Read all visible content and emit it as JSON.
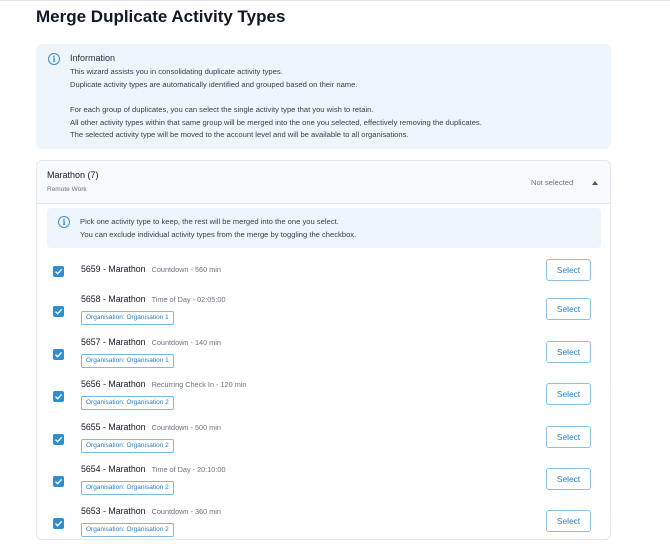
{
  "page": {
    "title": "Merge Duplicate Activity Types"
  },
  "info": {
    "heading": "Information",
    "lines": [
      "This wizard assists you in consolidating duplicate activity types.",
      "Duplicate activity types are automatically identified and grouped based on their name.",
      "For each group of duplicates, you can select the single activity type that you wish to retain.",
      "All other activity types within that same group will be merged into the one you selected, effectively removing the duplicates.",
      "The selected activity type will be moved to the account level and will be available to all organisations."
    ]
  },
  "group": {
    "title": "Marathon (7)",
    "subtitle": "Remote Work",
    "status": "Not selected",
    "hint": [
      "Pick one activity type to keep, the rest will be merged into the one you select.",
      "You can exclude individual activity types from the merge by toggling the checkbox."
    ],
    "select_label": "Select",
    "items": [
      {
        "name": "5659 - Marathon",
        "meta": "Countdown - 560 min",
        "tag": ""
      },
      {
        "name": "5658 - Marathon",
        "meta": "Time of Day - 02:05:00",
        "tag": "Organisation: Organisation 1"
      },
      {
        "name": "5657 - Marathon",
        "meta": "Countdown - 140 min",
        "tag": "Organisation: Organisation 1"
      },
      {
        "name": "5656 - Marathon",
        "meta": "Recurring Check In - 120 min",
        "tag": "Organisation: Organisation 2"
      },
      {
        "name": "5655 - Marathon",
        "meta": "Countdown - 500 min",
        "tag": "Organisation: Organisation 2"
      },
      {
        "name": "5654 - Marathon",
        "meta": "Time of Day - 20:10:00",
        "tag": "Organisation: Organisation 2"
      },
      {
        "name": "5653 - Marathon",
        "meta": "Countdown - 360 min",
        "tag": "Organisation: Organisation 2"
      }
    ]
  }
}
